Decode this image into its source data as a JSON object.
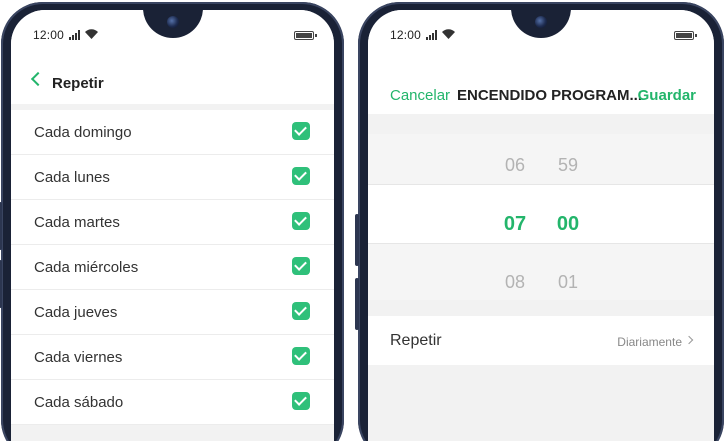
{
  "left_phone": {
    "status": {
      "time": "12:00",
      "signal_icon": "signal-icon",
      "wifi_icon": "wifi-icon",
      "battery_icon": "battery-icon"
    },
    "header": {
      "back_icon": "chevron-left-icon",
      "title": "Repetir"
    },
    "days": [
      {
        "label": "Cada domingo",
        "checked": true
      },
      {
        "label": "Cada lunes",
        "checked": true
      },
      {
        "label": "Cada martes",
        "checked": true
      },
      {
        "label": "Cada miércoles",
        "checked": true
      },
      {
        "label": "Cada jueves",
        "checked": true
      },
      {
        "label": "Cada viernes",
        "checked": true
      },
      {
        "label": "Cada sábado",
        "checked": true
      }
    ]
  },
  "right_phone": {
    "status": {
      "time": "12:00",
      "signal_icon": "signal-icon",
      "wifi_icon": "wifi-icon",
      "battery_icon": "battery-icon"
    },
    "header": {
      "cancel_label": "Cancelar",
      "title": "ENCENDIDO PROGRAM...",
      "save_label": "Guardar"
    },
    "picker": {
      "hours": {
        "prev": "06",
        "selected": "07",
        "next": "08"
      },
      "minutes": {
        "prev": "59",
        "selected": "00",
        "next": "01"
      }
    },
    "repeat": {
      "label": "Repetir",
      "value": "Diariamente",
      "chevron_icon": "chevron-right-icon"
    }
  },
  "colors": {
    "accent": "#23b56b",
    "check_fill": "#2fc07a",
    "frame": "#1a2236"
  }
}
